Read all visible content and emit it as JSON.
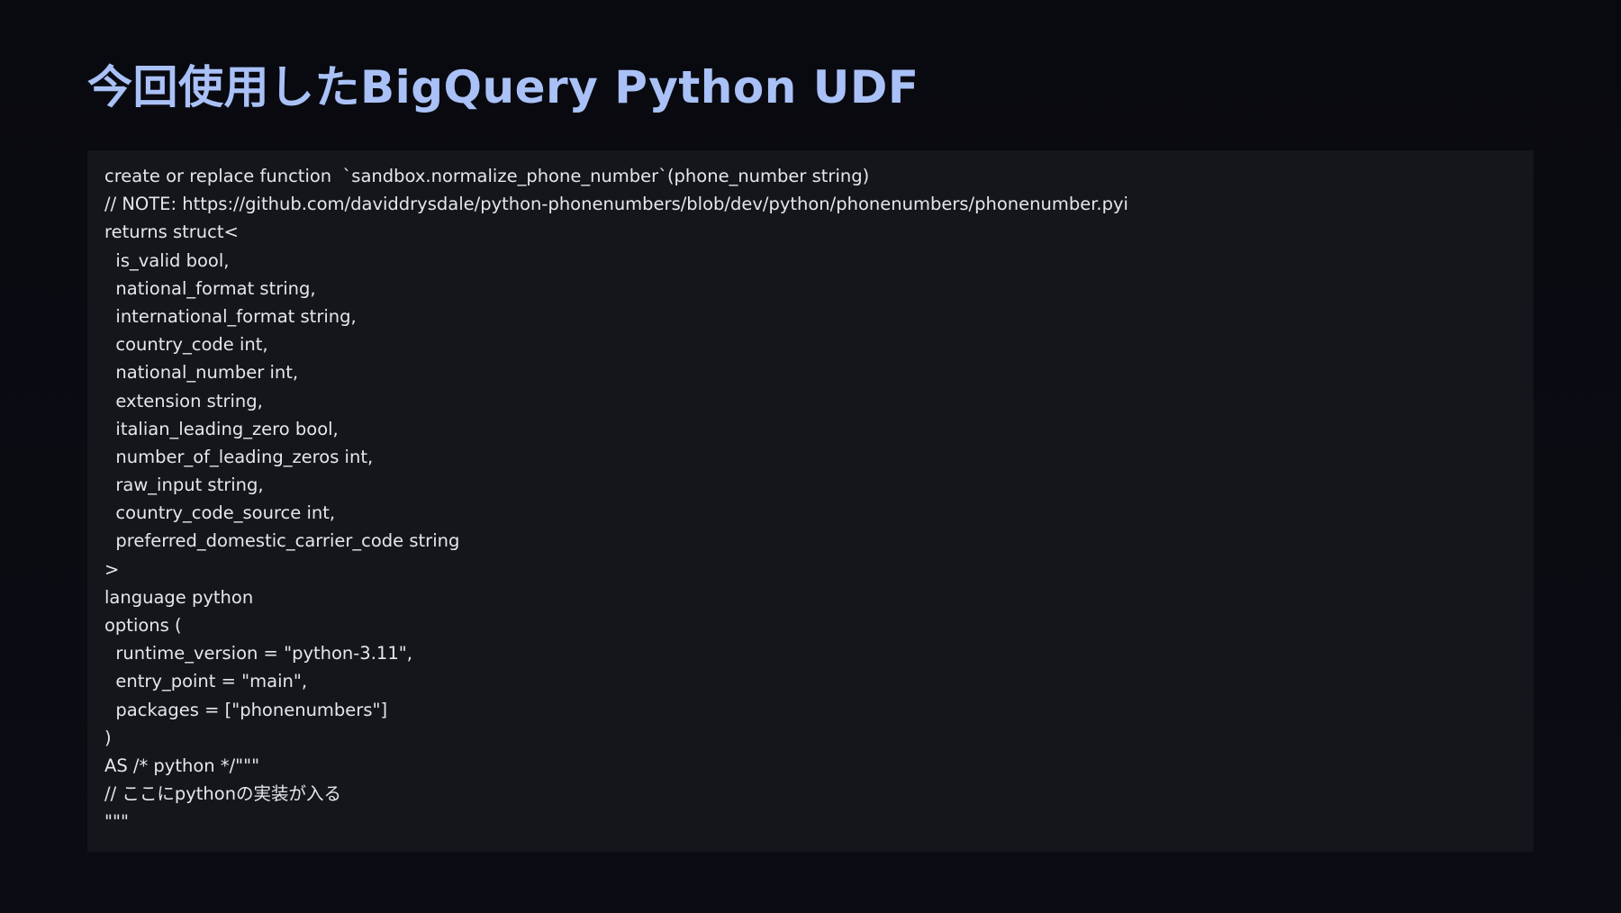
{
  "slide": {
    "title": "今回使用したBigQuery Python UDF"
  },
  "code": {
    "lines": [
      "create or replace function  `sandbox.normalize_phone_number`(phone_number string)",
      "// NOTE: https://github.com/daviddrysdale/python-phonenumbers/blob/dev/python/phonenumbers/phonenumber.pyi",
      "returns struct<",
      "  is_valid bool,",
      "  national_format string,",
      "  international_format string,",
      "  country_code int,",
      "  national_number int,",
      "  extension string,",
      "  italian_leading_zero bool,",
      "  number_of_leading_zeros int,",
      "  raw_input string,",
      "  country_code_source int,",
      "  preferred_domestic_carrier_code string",
      ">",
      "language python",
      "options (",
      "  runtime_version = \"python-3.11\",",
      "  entry_point = \"main\",",
      "  packages = [\"phonenumbers\"]",
      ")",
      "AS /* python */\"\"\"",
      "// ここにpythonの実装が入る",
      "\"\"\""
    ]
  },
  "colors": {
    "background": "#0b0c12",
    "title": "#a9c1f7",
    "code_panel": "#15161c",
    "code_text": "#e6e7ea"
  }
}
